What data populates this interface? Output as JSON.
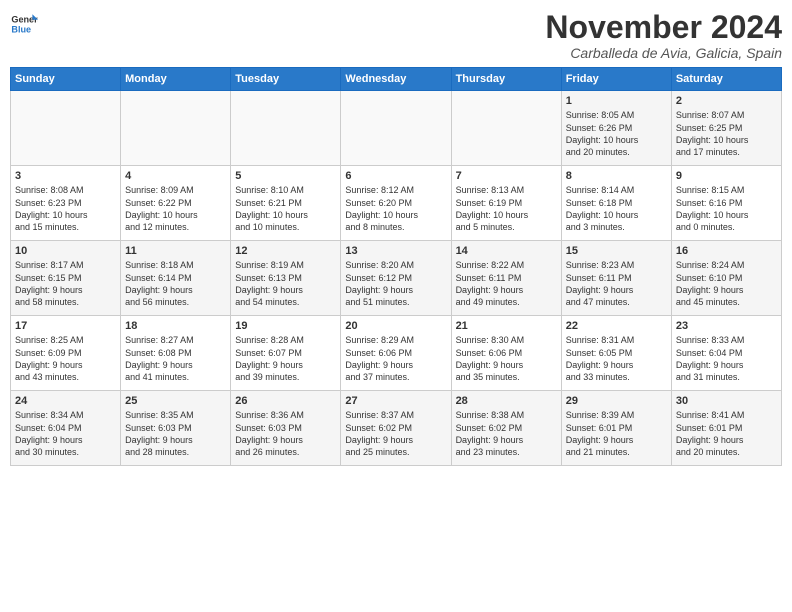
{
  "logo": {
    "line1": "General",
    "line2": "Blue"
  },
  "header": {
    "month": "November 2024",
    "location": "Carballeda de Avia, Galicia, Spain"
  },
  "weekdays": [
    "Sunday",
    "Monday",
    "Tuesday",
    "Wednesday",
    "Thursday",
    "Friday",
    "Saturday"
  ],
  "weeks": [
    [
      {
        "day": "",
        "info": ""
      },
      {
        "day": "",
        "info": ""
      },
      {
        "day": "",
        "info": ""
      },
      {
        "day": "",
        "info": ""
      },
      {
        "day": "",
        "info": ""
      },
      {
        "day": "1",
        "info": "Sunrise: 8:05 AM\nSunset: 6:26 PM\nDaylight: 10 hours\nand 20 minutes."
      },
      {
        "day": "2",
        "info": "Sunrise: 8:07 AM\nSunset: 6:25 PM\nDaylight: 10 hours\nand 17 minutes."
      }
    ],
    [
      {
        "day": "3",
        "info": "Sunrise: 8:08 AM\nSunset: 6:23 PM\nDaylight: 10 hours\nand 15 minutes."
      },
      {
        "day": "4",
        "info": "Sunrise: 8:09 AM\nSunset: 6:22 PM\nDaylight: 10 hours\nand 12 minutes."
      },
      {
        "day": "5",
        "info": "Sunrise: 8:10 AM\nSunset: 6:21 PM\nDaylight: 10 hours\nand 10 minutes."
      },
      {
        "day": "6",
        "info": "Sunrise: 8:12 AM\nSunset: 6:20 PM\nDaylight: 10 hours\nand 8 minutes."
      },
      {
        "day": "7",
        "info": "Sunrise: 8:13 AM\nSunset: 6:19 PM\nDaylight: 10 hours\nand 5 minutes."
      },
      {
        "day": "8",
        "info": "Sunrise: 8:14 AM\nSunset: 6:18 PM\nDaylight: 10 hours\nand 3 minutes."
      },
      {
        "day": "9",
        "info": "Sunrise: 8:15 AM\nSunset: 6:16 PM\nDaylight: 10 hours\nand 0 minutes."
      }
    ],
    [
      {
        "day": "10",
        "info": "Sunrise: 8:17 AM\nSunset: 6:15 PM\nDaylight: 9 hours\nand 58 minutes."
      },
      {
        "day": "11",
        "info": "Sunrise: 8:18 AM\nSunset: 6:14 PM\nDaylight: 9 hours\nand 56 minutes."
      },
      {
        "day": "12",
        "info": "Sunrise: 8:19 AM\nSunset: 6:13 PM\nDaylight: 9 hours\nand 54 minutes."
      },
      {
        "day": "13",
        "info": "Sunrise: 8:20 AM\nSunset: 6:12 PM\nDaylight: 9 hours\nand 51 minutes."
      },
      {
        "day": "14",
        "info": "Sunrise: 8:22 AM\nSunset: 6:11 PM\nDaylight: 9 hours\nand 49 minutes."
      },
      {
        "day": "15",
        "info": "Sunrise: 8:23 AM\nSunset: 6:11 PM\nDaylight: 9 hours\nand 47 minutes."
      },
      {
        "day": "16",
        "info": "Sunrise: 8:24 AM\nSunset: 6:10 PM\nDaylight: 9 hours\nand 45 minutes."
      }
    ],
    [
      {
        "day": "17",
        "info": "Sunrise: 8:25 AM\nSunset: 6:09 PM\nDaylight: 9 hours\nand 43 minutes."
      },
      {
        "day": "18",
        "info": "Sunrise: 8:27 AM\nSunset: 6:08 PM\nDaylight: 9 hours\nand 41 minutes."
      },
      {
        "day": "19",
        "info": "Sunrise: 8:28 AM\nSunset: 6:07 PM\nDaylight: 9 hours\nand 39 minutes."
      },
      {
        "day": "20",
        "info": "Sunrise: 8:29 AM\nSunset: 6:06 PM\nDaylight: 9 hours\nand 37 minutes."
      },
      {
        "day": "21",
        "info": "Sunrise: 8:30 AM\nSunset: 6:06 PM\nDaylight: 9 hours\nand 35 minutes."
      },
      {
        "day": "22",
        "info": "Sunrise: 8:31 AM\nSunset: 6:05 PM\nDaylight: 9 hours\nand 33 minutes."
      },
      {
        "day": "23",
        "info": "Sunrise: 8:33 AM\nSunset: 6:04 PM\nDaylight: 9 hours\nand 31 minutes."
      }
    ],
    [
      {
        "day": "24",
        "info": "Sunrise: 8:34 AM\nSunset: 6:04 PM\nDaylight: 9 hours\nand 30 minutes."
      },
      {
        "day": "25",
        "info": "Sunrise: 8:35 AM\nSunset: 6:03 PM\nDaylight: 9 hours\nand 28 minutes."
      },
      {
        "day": "26",
        "info": "Sunrise: 8:36 AM\nSunset: 6:03 PM\nDaylight: 9 hours\nand 26 minutes."
      },
      {
        "day": "27",
        "info": "Sunrise: 8:37 AM\nSunset: 6:02 PM\nDaylight: 9 hours\nand 25 minutes."
      },
      {
        "day": "28",
        "info": "Sunrise: 8:38 AM\nSunset: 6:02 PM\nDaylight: 9 hours\nand 23 minutes."
      },
      {
        "day": "29",
        "info": "Sunrise: 8:39 AM\nSunset: 6:01 PM\nDaylight: 9 hours\nand 21 minutes."
      },
      {
        "day": "30",
        "info": "Sunrise: 8:41 AM\nSunset: 6:01 PM\nDaylight: 9 hours\nand 20 minutes."
      }
    ]
  ]
}
